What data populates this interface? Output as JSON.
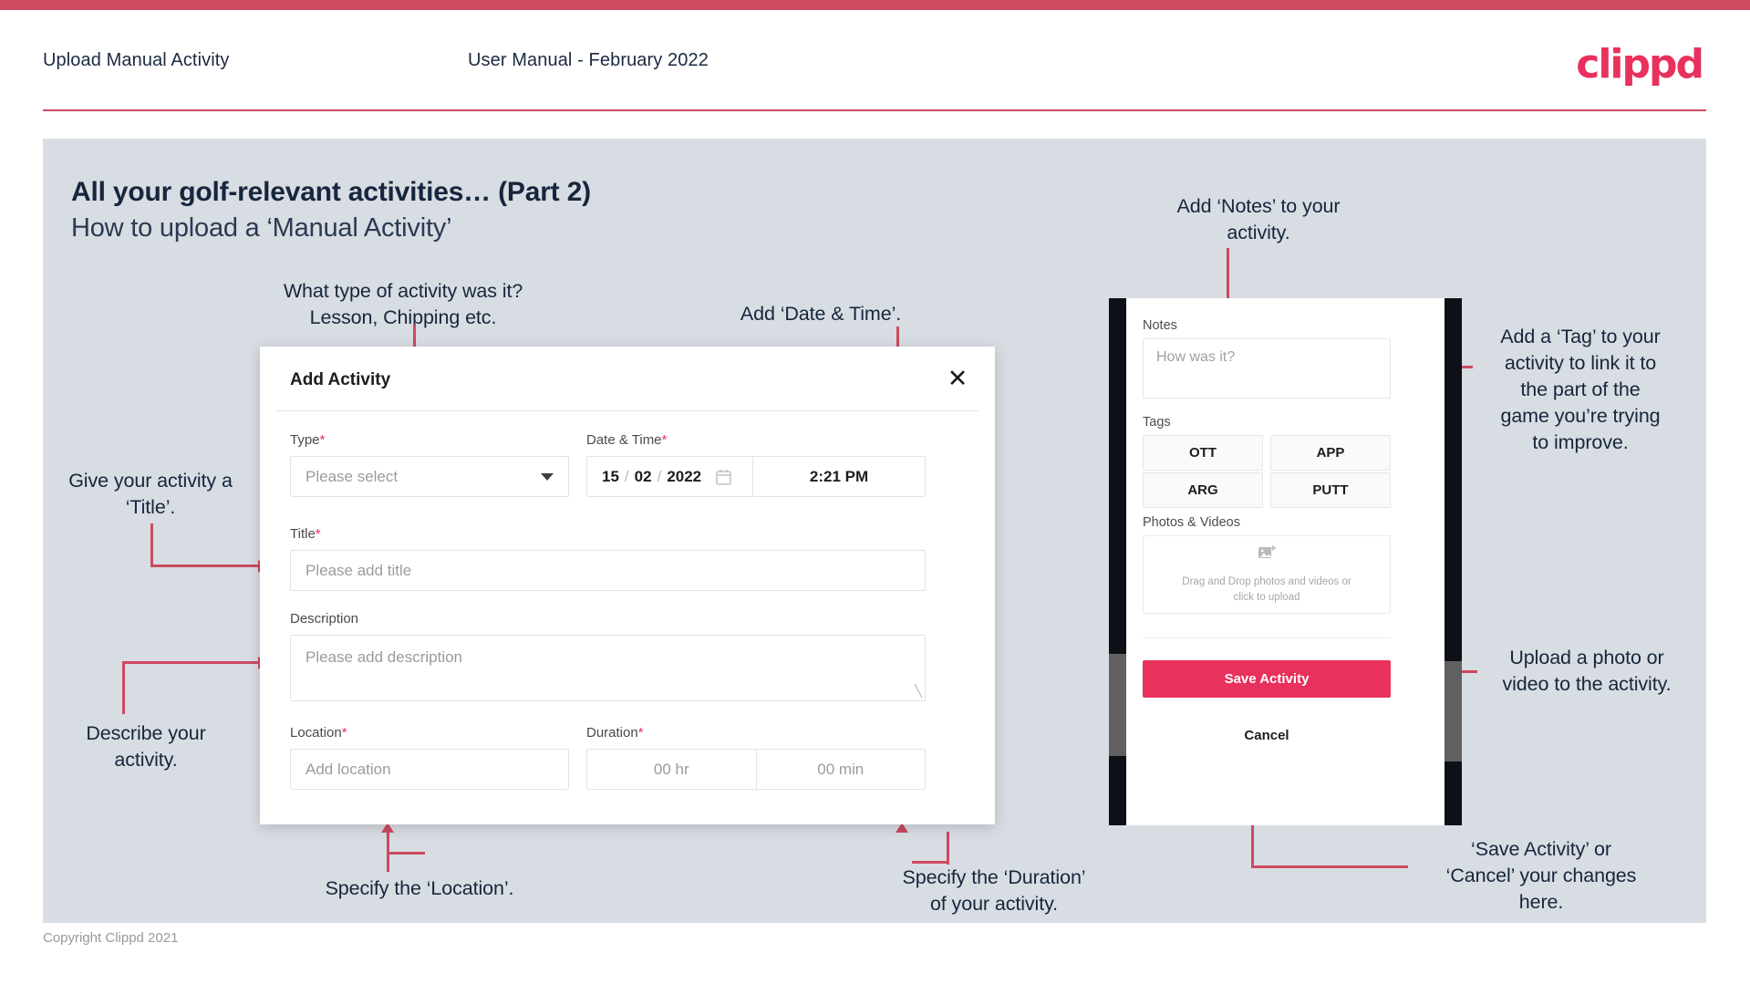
{
  "header": {
    "title": "Upload Manual Activity",
    "subtitle": "User Manual - February 2022",
    "logo": "clippd"
  },
  "slide": {
    "heading": "All your golf-relevant activities… (Part 2)",
    "subheading": "How to upload a ‘Manual Activity’"
  },
  "annotations": {
    "type": "What type of activity was it?\nLesson, Chipping etc.",
    "datetime": "Add ‘Date & Time’.",
    "title": "Give your activity a\n‘Title’.",
    "description": "Describe your\nactivity.",
    "location": "Specify the ‘Location’.",
    "duration": "Specify the ‘Duration’\nof your activity.",
    "notes": "Add ‘Notes’ to your\nactivity.",
    "tags": "Add a ‘Tag’ to your\nactivity to link it to\nthe part of the\ngame you’re trying\nto improve.",
    "upload": "Upload a photo or\nvideo to the activity.",
    "save": "‘Save Activity’ or\n‘Cancel’ your changes\nhere."
  },
  "dialog": {
    "title": "Add Activity",
    "close_icon": "close-icon",
    "fields": {
      "type": {
        "label": "Type",
        "required": "*",
        "placeholder": "Please select"
      },
      "datetime": {
        "label": "Date & Time",
        "required": "*",
        "day": "15",
        "month": "02",
        "year": "2022",
        "sep": "/",
        "time": "2:21 PM"
      },
      "title": {
        "label": "Title",
        "required": "*",
        "placeholder": "Please add title"
      },
      "description": {
        "label": "Description",
        "placeholder": "Please add description"
      },
      "location": {
        "label": "Location",
        "required": "*",
        "placeholder": "Add location"
      },
      "duration": {
        "label": "Duration",
        "required": "*",
        "hours": "00 hr",
        "minutes": "00 min"
      }
    }
  },
  "phone": {
    "notes_label": "Notes",
    "notes_placeholder": "How was it?",
    "tags_label": "Tags",
    "tags": [
      "OTT",
      "APP",
      "ARG",
      "PUTT"
    ],
    "photos_label": "Photos & Videos",
    "dropzone_text": "Drag and Drop photos and videos or\nclick to upload",
    "save_label": "Save Activity",
    "cancel_label": "Cancel"
  },
  "footer": {
    "copyright": "Copyright Clippd 2021"
  },
  "colors": {
    "brand_pink": "#e8315c",
    "topbar": "#cd4a60",
    "slide_bg": "#d8dde3",
    "text_dark": "#16263c"
  }
}
